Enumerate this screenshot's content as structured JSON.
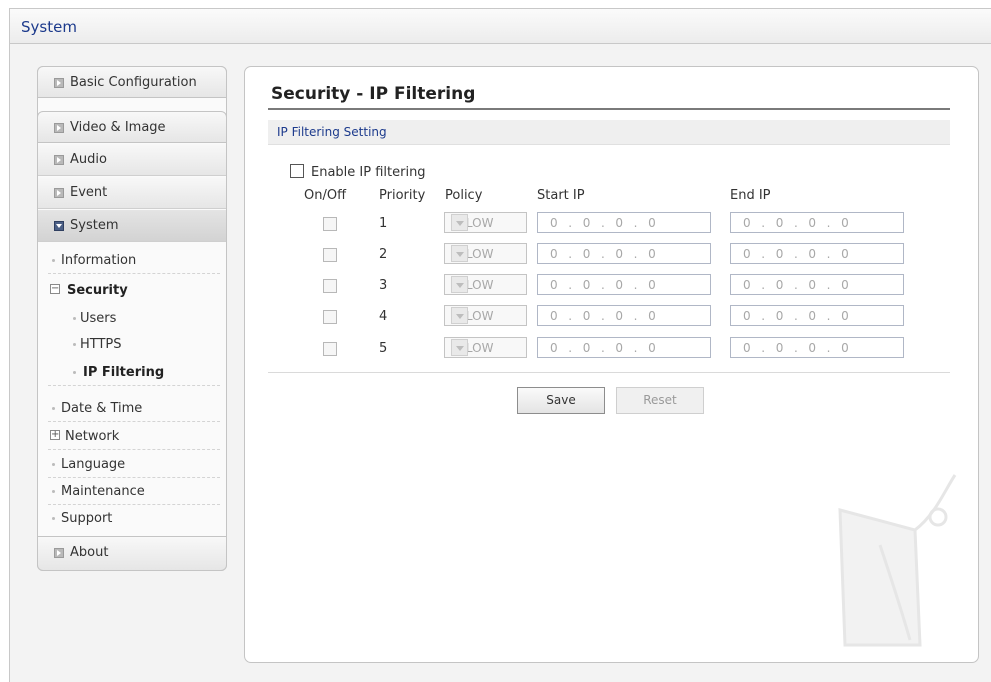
{
  "header": {
    "title": "System"
  },
  "sidebar": {
    "buttons": {
      "basic": "Basic Configuration",
      "video": "Video & Image",
      "audio": "Audio",
      "event": "Event",
      "system": "System",
      "about": "About"
    },
    "system_items": {
      "information": "Information",
      "security": "Security",
      "users": "Users",
      "https": "HTTPS",
      "ip_filtering": "IP Filtering",
      "date_time": "Date & Time",
      "network": "Network",
      "language": "Language",
      "maintenance": "Maintenance",
      "support": "Support"
    }
  },
  "page": {
    "title": "Security - IP Filtering",
    "section": "IP Filtering Setting",
    "enable_label": "Enable IP filtering",
    "enable_checked": false,
    "columns": {
      "onoff": "On/Off",
      "priority": "Priority",
      "policy": "Policy",
      "start_ip": "Start IP",
      "end_ip": "End IP"
    },
    "rows": [
      {
        "priority": "1",
        "policy": "ALLOW",
        "start_ip": "0  .  0  .  0  .  0",
        "end_ip": "0  .  0  .  0  .  0"
      },
      {
        "priority": "2",
        "policy": "ALLOW",
        "start_ip": "0  .  0  .  0  .  0",
        "end_ip": "0  .  0  .  0  .  0"
      },
      {
        "priority": "3",
        "policy": "ALLOW",
        "start_ip": "0  .  0  .  0  .  0",
        "end_ip": "0  .  0  .  0  .  0"
      },
      {
        "priority": "4",
        "policy": "ALLOW",
        "start_ip": "0  .  0  .  0  .  0",
        "end_ip": "0  .  0  .  0  .  0"
      },
      {
        "priority": "5",
        "policy": "ALLOW",
        "start_ip": "0  .  0  .  0  .  0",
        "end_ip": "0  .  0  .  0  .  0"
      }
    ],
    "buttons": {
      "save": "Save",
      "reset": "Reset"
    }
  },
  "colors": {
    "link_blue": "#1c3a8c",
    "active_square": "#4b5f86"
  }
}
